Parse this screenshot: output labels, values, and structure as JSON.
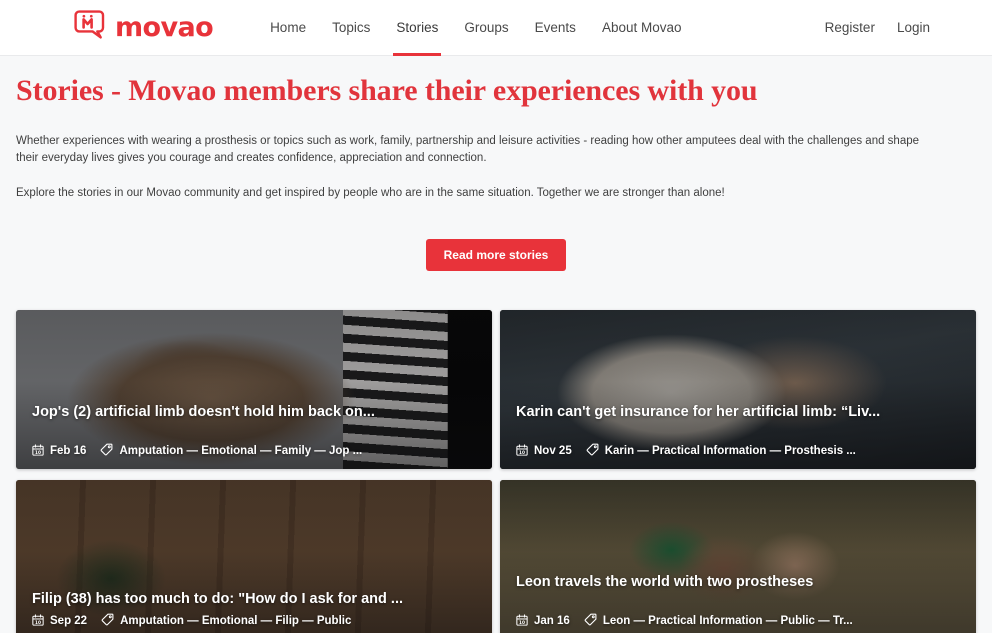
{
  "brand": {
    "word": "movao",
    "logo_icon": "movao-speech-bubble-m-logo",
    "color": "#e8333a"
  },
  "header": {
    "nav": [
      {
        "label": "Home",
        "active": false
      },
      {
        "label": "Topics",
        "active": false
      },
      {
        "label": "Stories",
        "active": true
      },
      {
        "label": "Groups",
        "active": false
      },
      {
        "label": "Events",
        "active": false
      },
      {
        "label": "About Movao",
        "active": false
      }
    ],
    "auth": [
      {
        "label": "Register"
      },
      {
        "label": "Login"
      }
    ],
    "active_underline_color": "#e8333a"
  },
  "main": {
    "title": "Stories - Movao members share their experiences with you",
    "title_color": "#e1343c",
    "paragraphs": [
      "Whether experiences with wearing a prosthesis or topics such as work, family, partnership and leisure activities - reading how other amputees deal with the challenges and shape their everyday lives gives you courage and creates confidence, appreciation and connection.",
      "Explore the stories in our Movao community and get inspired by people who are in the same situation. Together we are stronger than alone!"
    ],
    "cta": {
      "label": "Read more stories",
      "color": "#e8333a"
    }
  },
  "stories": [
    {
      "title": "Jop's (2) artificial limb doesn't hold him back on...",
      "date": "Feb 16",
      "tags": "Amputation — Emotional — Family — Jop ...",
      "date_icon": "calendar-icon",
      "tag_icon": "tag-icon",
      "photo_class": "photo-teddy",
      "photo_alt": "teddy-bear-photo",
      "two_line": false
    },
    {
      "title": "Karin can't get insurance for her artificial limb: “Liv...",
      "date": "Nov 25",
      "tags": "Karin — Practical Information — Prosthesis ...",
      "date_icon": "calendar-icon",
      "tag_icon": "tag-icon",
      "photo_class": "photo-writing",
      "photo_alt": "hand-writing-with-pen-photo",
      "two_line": false
    },
    {
      "title": "Filip (38) has too much to do: \"How do I ask for and ...",
      "date": "Sep 22",
      "tags": "Amputation — Emotional — Filip — Public",
      "date_icon": "calendar-icon",
      "tag_icon": "tag-icon",
      "photo_class": "photo-boxes",
      "photo_alt": "moving-boxes-photo",
      "two_line": true
    },
    {
      "title": "Leon travels the world with two prostheses",
      "date": "Jan 16",
      "tags": "Leon — Practical Information — Public — Tr...",
      "date_icon": "calendar-icon",
      "tag_icon": "tag-icon",
      "photo_class": "photo-travel",
      "photo_alt": "two-men-travelling-photo",
      "two_line": false
    }
  ]
}
